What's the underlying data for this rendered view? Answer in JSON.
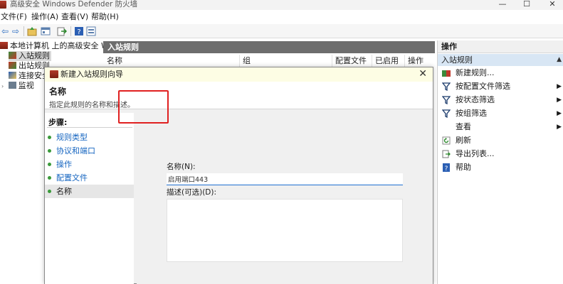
{
  "window": {
    "title": "高级安全 Windows Defender 防火墙",
    "controls": {
      "minimize": "—",
      "maximize": "☐",
      "close": "✕"
    }
  },
  "menu": [
    "文件(F)",
    "操作(A)",
    "查看(V)",
    "帮助(H)"
  ],
  "toolbar": {
    "icons": [
      "back-icon",
      "forward-icon",
      "up-folder-icon",
      "show-hide-tree-icon",
      "export-icon",
      "help-icon",
      "properties-icon"
    ]
  },
  "tree": {
    "root": "本地计算机 上的高级安全 Windc",
    "items": [
      "入站规则",
      "出站规则",
      "连接安全",
      "监视"
    ]
  },
  "center": {
    "header": "入站规则",
    "columns": [
      "名称",
      "组",
      "配置文件",
      "已启用",
      "操作"
    ]
  },
  "actions": {
    "header": "操作",
    "section": "入站规则",
    "items": [
      {
        "label": "新建规则...",
        "icon": "new-rule-icon",
        "submenu": false
      },
      {
        "label": "按配置文件筛选",
        "icon": "filter-icon",
        "submenu": true
      },
      {
        "label": "按状态筛选",
        "icon": "filter-icon",
        "submenu": true
      },
      {
        "label": "按组筛选",
        "icon": "filter-icon",
        "submenu": true
      },
      {
        "label": "查看",
        "icon": "",
        "submenu": true
      },
      {
        "label": "刷新",
        "icon": "refresh-icon",
        "submenu": false
      },
      {
        "label": "导出列表...",
        "icon": "export-list-icon",
        "submenu": false
      },
      {
        "label": "帮助",
        "icon": "help-icon",
        "submenu": false
      }
    ]
  },
  "dialog": {
    "title": "新建入站规则向导",
    "close": "✕",
    "heading": "名称",
    "subheading": "指定此规则的名称和描述。",
    "steps_title": "步骤:",
    "steps": [
      "规则类型",
      "协议和端口",
      "操作",
      "配置文件",
      "名称"
    ],
    "current_step": "名称",
    "name_label": "名称(N):",
    "name_value": "启用端口443",
    "desc_label": "描述(可选)(D):",
    "desc_value": ""
  },
  "colors": {
    "accent": "#1f6fd1",
    "highlight_box": "#e02020",
    "panel_header": "#6d6d6d",
    "selection": "#d8e6f4"
  }
}
